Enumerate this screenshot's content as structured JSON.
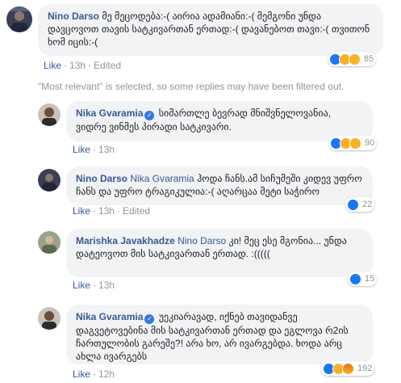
{
  "notice": "\"Most relevant\" is selected, so some replies may have been filtered out.",
  "colors": {
    "link": "#385898",
    "bubble": "#f2f3f5",
    "meta": "#90949c",
    "verified": "#3578e5"
  },
  "comments": [
    {
      "author": "Nino Darso",
      "text": "მე მეცოდება:-( აირია ადამიანი:-( მემგონი უნდა დავცოვოთ თავის სატკივართან ერთად:-( დავანებოთ თავი:-( თვითონ ხომ იცის:-(",
      "like": "Like",
      "time": "13h",
      "edited": "Edited",
      "reaction_count": "85",
      "reactions": [
        "like-icon",
        "haha-icon",
        "sad-icon"
      ]
    },
    {
      "author": "Nika Gvaramia",
      "verified": true,
      "text": "სიმართლე ბევრად მნიშვნელოვანია, ვიდრე ვინმეს პირადი სატკივარი.",
      "like": "Like",
      "time": "13h",
      "reaction_count": "90",
      "reactions": [
        "like-icon",
        "haha-icon",
        "sad-icon"
      ]
    },
    {
      "author": "Nino Darso",
      "mention": "Nika Gvaramia",
      "text": "ჰოდა ჩანს.ამ სიჩუმეში კიდევ უფრო ჩანს და უფრო ტრაგიკულია:-( აღარცაა მეტი საჭირო",
      "like": "Like",
      "time": "13h",
      "edited": "Edited",
      "reaction_count": "22",
      "reactions": [
        "like-icon"
      ]
    },
    {
      "author": "Marishka Javakhadze",
      "mention": "Nino Darso",
      "text": "კი! მეც ესე მგონია... უნდა დატეოვოთ მის სატკივართან ერთად. :(((((",
      "like": "Like",
      "time": "13h",
      "reaction_count": "15",
      "reactions": [
        "like-icon"
      ]
    },
    {
      "author": "Nika Gvaramia",
      "verified": true,
      "text": "უეკიარავად, იქნებ თავიდანვე დაგვეტოვებინა მის სატკივართან ერთად და ეგლოვა რ2ის ჩართულობის გარეშე?! არა ხო, არ ივარგებდა. ხოდა არც ახლა ივარგებს",
      "like": "Like",
      "time": "12h",
      "reaction_count": "192",
      "reactions": [
        "like-icon",
        "haha-icon",
        "angry-icon"
      ]
    }
  ]
}
